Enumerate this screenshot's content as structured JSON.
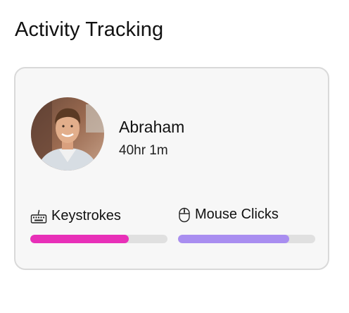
{
  "header": {
    "title": "Activity Tracking"
  },
  "user": {
    "name": "Abraham",
    "time": "40hr 1m"
  },
  "metrics": [
    {
      "label": "Keystrokes",
      "icon": "keyboard-icon",
      "progress": 0.72,
      "color": "#e830b8"
    },
    {
      "label": "Mouse Clicks",
      "icon": "mouse-icon",
      "progress": 0.81,
      "color": "#a98ef0"
    }
  ]
}
